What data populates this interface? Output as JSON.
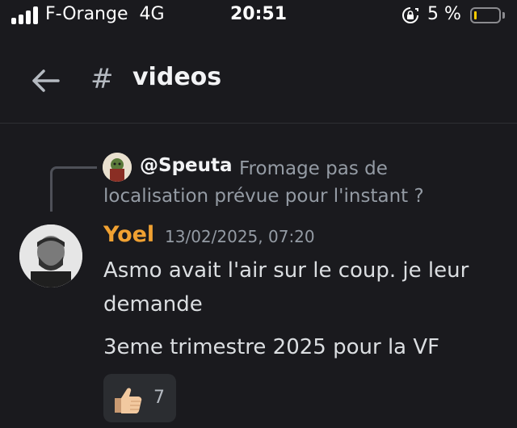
{
  "status_bar": {
    "carrier": "F-Orange",
    "network": "4G",
    "time": "20:51",
    "battery": "5 %",
    "battery_level": 0.05
  },
  "header": {
    "hash": "#",
    "channel": "videos"
  },
  "reply": {
    "author": "@Speuta",
    "text": "Fromage pas de localisation prévue pour l'instant ?"
  },
  "message": {
    "author": "Yoel",
    "author_color": "#f0a132",
    "timestamp": "13/02/2025, 07:20",
    "lines": [
      "Asmo avait l'air sur le coup. je leur demande",
      "3eme trimestre 2025 pour la VF"
    ]
  },
  "reaction": {
    "emoji": "thumbs-up-icon",
    "count": "7"
  },
  "colors": {
    "background": "#1a1a1e",
    "muted": "#949ba4",
    "battery_low": "#ffcc00"
  }
}
